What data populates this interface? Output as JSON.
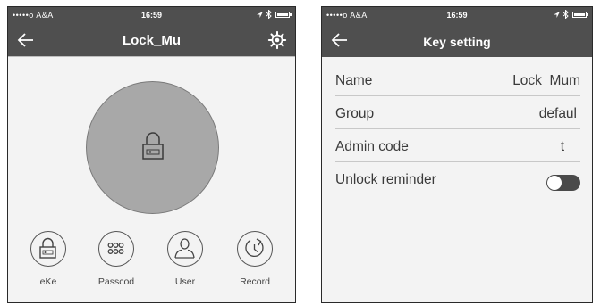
{
  "left": {
    "status": {
      "carrier": "•••••o A&A",
      "time": "16:59",
      "battery_level": 0.85
    },
    "title": "Lock_Mu",
    "actions": [
      {
        "label": "eKe",
        "icon": "padlock-icon"
      },
      {
        "label": "Passcod",
        "icon": "keypad-icon"
      },
      {
        "label": "User",
        "icon": "user-icon"
      },
      {
        "label": "Record",
        "icon": "history-icon"
      }
    ]
  },
  "right": {
    "status": {
      "carrier": "•••••o A&A",
      "time": "16:59",
      "battery_level": 0.85
    },
    "title": "Key setting",
    "rows": [
      {
        "label": "Name",
        "value": "Lock_Mum"
      },
      {
        "label": "Group",
        "value": "defaul"
      },
      {
        "label": "Admin code",
        "value": "t"
      },
      {
        "label": "Unlock reminder",
        "toggle": false
      }
    ]
  },
  "colors": {
    "header": "#4f4f4f",
    "background": "#f3f3f3",
    "circle": "#a8a8a8"
  }
}
